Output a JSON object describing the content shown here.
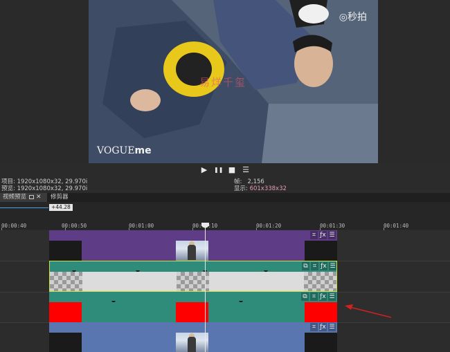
{
  "preview": {
    "watermark": "◎秒拍",
    "logo_vogue": "VOGUE",
    "logo_me": "me",
    "overlay_text": "易烊千玺"
  },
  "transport": {
    "play": "▶",
    "pause": "❚❚",
    "stop": "■",
    "menu": "☰"
  },
  "info": {
    "project_label": "项目:",
    "project_value": "1920x1080x32, 29.970i",
    "preview_label": "预览:",
    "preview_value": "1920x1080x32, 29.970i",
    "frame_label": "帧:",
    "frame_value": "2,156",
    "display_label": "显示:",
    "display_value": "601x338x32"
  },
  "tabs": {
    "video_preview": "视频预览",
    "trimmer": "修剪器",
    "close": "✕"
  },
  "timeline": {
    "position_badge": "+44.28",
    "ruler_labels": [
      "00:00:40",
      "00:00:50",
      "00:01:00",
      "00:01:10",
      "00:01:20",
      "00:01:30",
      "00:01:40"
    ]
  },
  "clip_icons": {
    "crop": "⌗",
    "fx": "ƒx",
    "menu": "☰",
    "pan": "⧉"
  },
  "colors": {
    "purple_track": "#5e3d86",
    "green_track": "#2f8c7a",
    "blue_track": "#5a76b0",
    "red_segment": "#ff0000",
    "selected_outline": "#c8e03a",
    "arrow": "#d42020"
  }
}
